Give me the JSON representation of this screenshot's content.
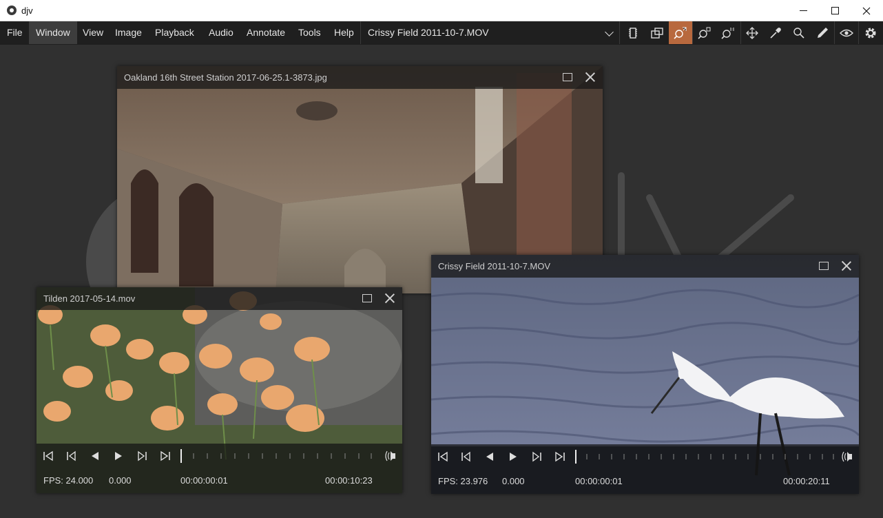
{
  "window": {
    "title": "djv",
    "icon": "djv-film-reel-icon",
    "minimize_icon": "minimize-icon",
    "maximize_icon": "maximize-icon",
    "close_icon": "close-icon"
  },
  "menu": [
    "File",
    "Window",
    "View",
    "Image",
    "Playback",
    "Audio",
    "Annotate",
    "Tools",
    "Help"
  ],
  "active_menu": "Window",
  "current_file": "Crissy Field 2011-10-7.MOV",
  "toolbar": [
    {
      "name": "frame-view-icon"
    },
    {
      "name": "window-fit-icon"
    },
    {
      "name": "zoom-fit-icon",
      "active": true
    },
    {
      "name": "zoom-fit-alt-icon"
    },
    {
      "name": "zoom-one-to-one-icon"
    },
    {
      "name": "pan-move-icon"
    },
    {
      "name": "color-picker-icon"
    },
    {
      "name": "magnify-icon"
    },
    {
      "name": "annotate-pen-icon"
    },
    {
      "name": "visibility-eye-icon"
    },
    {
      "name": "settings-gear-icon"
    }
  ],
  "accent_color": "#b8693e",
  "windows": [
    {
      "id": "oakland",
      "title": "Oakland 16th Street Station 2017-06-25.1-3873.jpg"
    },
    {
      "id": "tilden",
      "title": "Tilden 2017-05-14.mov",
      "fps": "FPS: 24.000",
      "speed": "0.000",
      "current_time": "00:00:00:01",
      "duration": "00:00:10:23"
    },
    {
      "id": "crissy",
      "title": "Crissy Field 2011-10-7.MOV",
      "fps": "FPS: 23.976",
      "speed": "0.000",
      "current_time": "00:00:00:01",
      "duration": "00:00:20:11"
    }
  ]
}
